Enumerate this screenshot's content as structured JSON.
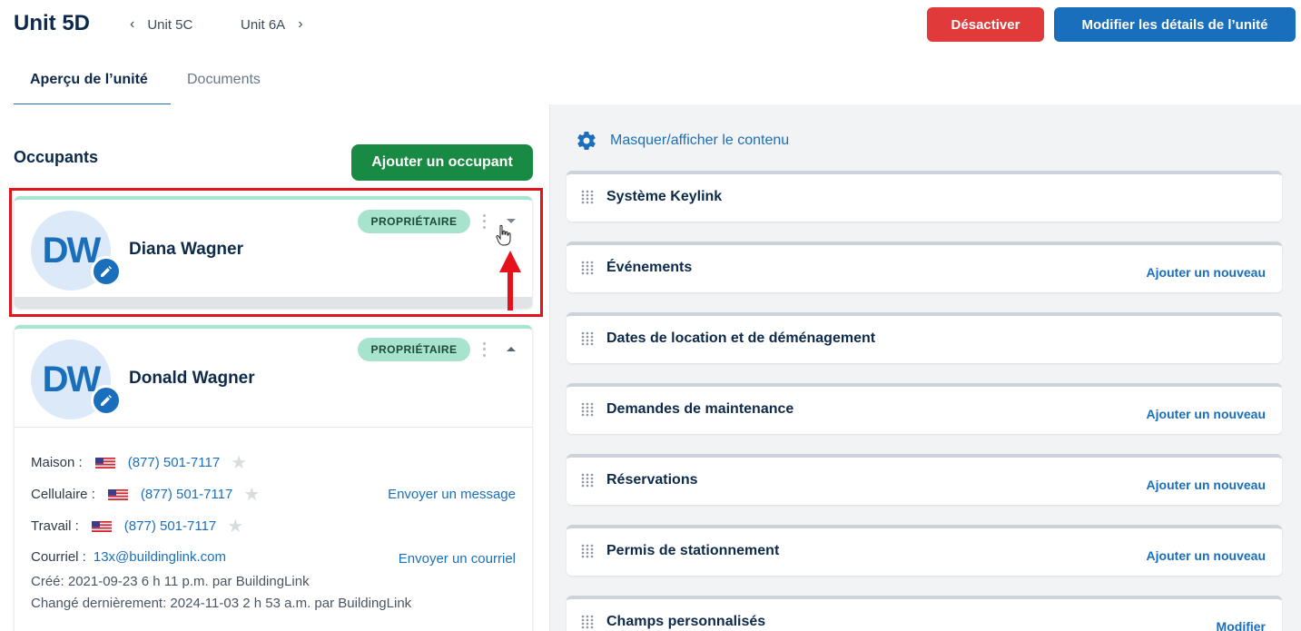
{
  "header": {
    "unit_title": "Unit 5D",
    "prev_unit": "Unit 5C",
    "next_unit": "Unit 6A",
    "deactivate_label": "Désactiver",
    "edit_label": "Modifier les détails de l’unité"
  },
  "tabs": [
    {
      "label": "Aperçu de l’unité",
      "active": true
    },
    {
      "label": "Documents",
      "active": false
    }
  ],
  "occupants": {
    "title": "Occupants",
    "add_label": "Ajouter un occupant",
    "list": [
      {
        "initials": "DW",
        "name": "Diana Wagner",
        "role": "PROPRIÉTAIRE",
        "expanded": false
      },
      {
        "initials": "DW",
        "name": "Donald Wagner",
        "role": "PROPRIÉTAIRE",
        "expanded": true,
        "home_label": "Maison :",
        "home_phone": "(877) 501-7117",
        "cell_label": "Cellulaire :",
        "cell_phone": "(877) 501-7117",
        "cell_action": "Envoyer un message",
        "work_label": "Travail :",
        "work_phone": "(877) 501-7117",
        "email_label": "Courriel :",
        "email": "13x@buildinglink.com",
        "email_action": "Envoyer un courriel",
        "created": "Créé:  2021-09-23 6 h 11 p.m. par BuildingLink",
        "changed": "Changé dernièrement:  2024-11-03 2 h 53 a.m. par BuildingLink"
      }
    ]
  },
  "right": {
    "toggle_label": "Masquer/afficher le contenu",
    "sections": [
      {
        "title": "Système Keylink",
        "action": ""
      },
      {
        "title": "Événements",
        "action": "Ajouter un nouveau"
      },
      {
        "title": "Dates de location et de déménagement",
        "action": ""
      },
      {
        "title": "Demandes de maintenance",
        "action": "Ajouter un nouveau"
      },
      {
        "title": "Réservations",
        "action": "Ajouter un nouveau"
      },
      {
        "title": "Permis de stationnement",
        "action": "Ajouter un nouveau"
      },
      {
        "title": "Champs personnalisés",
        "action": "Modifier"
      }
    ]
  },
  "colors": {
    "primary": "#1a6fbd",
    "danger": "#e03a3a",
    "success": "#198a43",
    "owner_badge": "#a8e3cd",
    "highlight": "#e4121b"
  }
}
